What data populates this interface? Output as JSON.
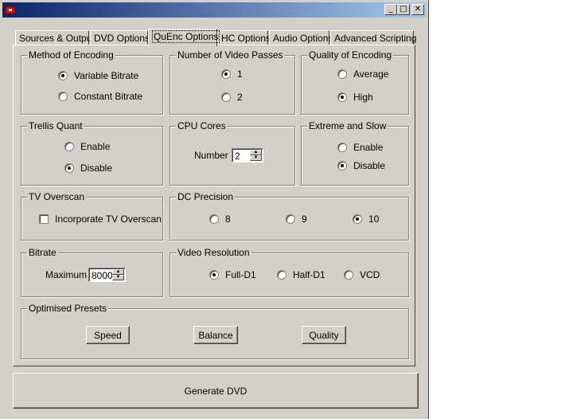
{
  "window": {
    "title": "",
    "minimize_glyph": "_",
    "maximize_glyph": "□",
    "close_glyph": "✕"
  },
  "tabs": [
    {
      "label": "Sources & Output"
    },
    {
      "label": "DVD Options"
    },
    {
      "label": "QuEnc Options"
    },
    {
      "label": "HC Options"
    },
    {
      "label": "Audio Options"
    },
    {
      "label": "Advanced Scripting"
    }
  ],
  "groups": {
    "method": {
      "title": "Method of Encoding",
      "options": [
        {
          "label": "Variable Bitrate",
          "selected": true
        },
        {
          "label": "Constant Bitrate",
          "selected": false
        }
      ]
    },
    "passes": {
      "title": "Number of Video Passes",
      "options": [
        {
          "label": "1",
          "selected": true
        },
        {
          "label": "2",
          "selected": false
        }
      ]
    },
    "quality": {
      "title": "Quality of Encoding",
      "options": [
        {
          "label": "Average",
          "selected": false
        },
        {
          "label": "High",
          "selected": true
        }
      ]
    },
    "trellis": {
      "title": "Trellis Quant",
      "options": [
        {
          "label": "Enable",
          "selected": false
        },
        {
          "label": "Disable",
          "selected": true
        }
      ]
    },
    "cpu": {
      "title": "CPU Cores",
      "number_label": "Number",
      "number_value": "2"
    },
    "extreme": {
      "title": "Extreme and Slow",
      "options": [
        {
          "label": "Enable",
          "selected": false
        },
        {
          "label": "Disable",
          "selected": true
        }
      ]
    },
    "overscan": {
      "title": "TV Overscan",
      "checkbox_label": "Incorporate TV Overscan",
      "checked": false
    },
    "dc": {
      "title": "DC Precision",
      "options": [
        {
          "label": "8",
          "selected": false
        },
        {
          "label": "9",
          "selected": false
        },
        {
          "label": "10",
          "selected": true
        }
      ]
    },
    "bitrate": {
      "title": "Bitrate",
      "max_label": "Maximum",
      "max_value": "8000"
    },
    "resolution": {
      "title": "Video Resolution",
      "options": [
        {
          "label": "Full-D1",
          "selected": true
        },
        {
          "label": "Half-D1",
          "selected": false
        },
        {
          "label": "VCD",
          "selected": false
        }
      ]
    },
    "presets": {
      "title": "Optimised Presets",
      "buttons": [
        "Speed",
        "Balance",
        "Quality"
      ]
    }
  },
  "generate_label": "Generate DVD"
}
